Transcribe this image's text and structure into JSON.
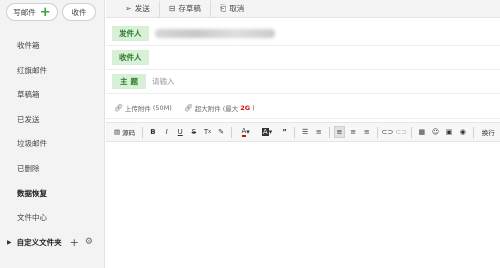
{
  "sidebar": {
    "write_label": "写邮件",
    "receive_label": "收件",
    "items": [
      {
        "label": "收件箱"
      },
      {
        "label": "红旗邮件"
      },
      {
        "label": "草稿箱"
      },
      {
        "label": "已发送"
      },
      {
        "label": "垃圾邮件"
      },
      {
        "label": "已删除"
      },
      {
        "label": "数据恢复"
      },
      {
        "label": "文件中心"
      }
    ],
    "folder_label": "自定义文件夹"
  },
  "toolbar": {
    "send_label": "发送",
    "draft_label": "存草稿",
    "cancel_label": "取消"
  },
  "compose": {
    "sender_label": "发件人",
    "recipient_label": "收件人",
    "subject_label": "主题",
    "subject_placeholder": "请输入"
  },
  "attachments": {
    "upload_label": "上传附件",
    "upload_limit": "(50M)",
    "large_label": "超大附件",
    "large_limit_prefix": "(最大",
    "large_limit_value": "2G",
    "large_limit_suffix": ")"
  },
  "editor": {
    "source_label": "源码",
    "newline_label": "换行"
  },
  "colors": {
    "accent_green": "#2fa53a",
    "tag_bg": "#d8f0d8",
    "tag_text": "#2a7a2a",
    "limit_red": "#d01010"
  }
}
